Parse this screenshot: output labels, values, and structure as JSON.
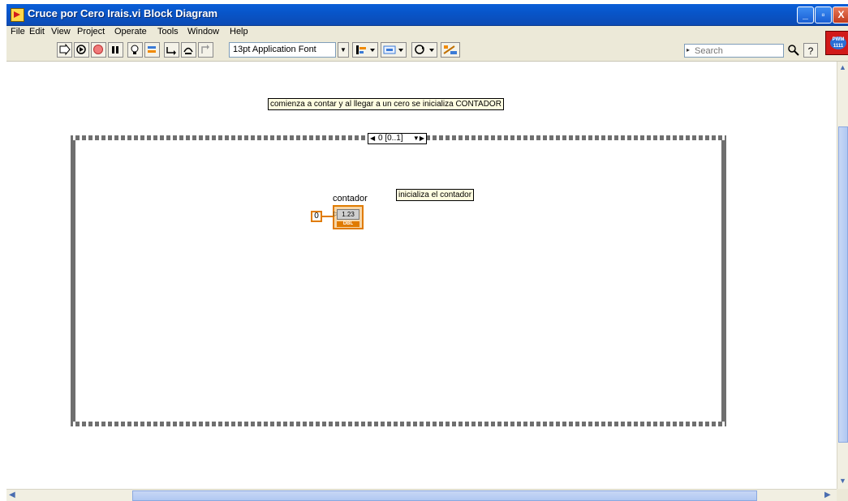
{
  "window": {
    "title": "Cruce por Cero Irais.vi Block Diagram",
    "buttons": {
      "minimize": "_",
      "maximize": "▫",
      "close": "X"
    }
  },
  "menu": [
    "File",
    "Edit",
    "View",
    "Project",
    "Operate",
    "Tools",
    "Window",
    "Help"
  ],
  "toolbar": {
    "font": "13pt Application Font",
    "search_placeholder": "Search",
    "help": "?"
  },
  "vi_icon": {
    "text": "PWM\n1111"
  },
  "diagram": {
    "comment_top": "comienza a contar y al llegar a un cero se inicializa CONTADOR",
    "comment_inner": "inicializa el contador",
    "sequence_selector": "0 [0..1]",
    "constant_value": "0",
    "indicator": {
      "label": "contador",
      "display": "1.23",
      "type": "DBL"
    }
  },
  "icons": {
    "run": "run-arrow-icon",
    "continuous": "run-continuously-icon",
    "abort": "abort-icon",
    "pause": "pause-icon",
    "highlight": "highlight-execution-icon",
    "retain": "retain-wire-values-icon",
    "step_into": "step-into-icon",
    "step_over": "step-over-icon",
    "step_out": "step-out-icon",
    "align": "align-objects-icon",
    "distribute": "distribute-objects-icon",
    "reorder": "reorder-icon",
    "cleanup": "clean-up-diagram-icon"
  }
}
